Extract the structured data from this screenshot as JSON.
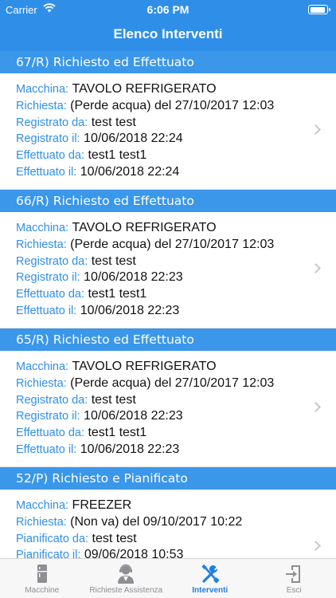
{
  "status_bar": {
    "carrier": "Carrier",
    "time": "6:06 PM",
    "battery_level": 0.95
  },
  "header": {
    "title": "Elenco Interventi"
  },
  "interventions": [
    {
      "header": "67/R) Richiesto ed Effettuato",
      "rows": [
        {
          "label": "Macchina:",
          "value": "TAVOLO REFRIGERATO"
        },
        {
          "label": "Richiesta:",
          "value": " (Perde acqua) del 27/10/2017 12:03"
        },
        {
          "label": "Registrato da:",
          "value": "test test"
        },
        {
          "label": "Registrato il:",
          "value": "10/06/2018 22:24"
        },
        {
          "label": "Effettuato da:",
          "value": "test1 test1"
        },
        {
          "label": "Effettuato il:",
          "value": "10/06/2018 22:24"
        }
      ]
    },
    {
      "header": "66/R) Richiesto ed Effettuato",
      "rows": [
        {
          "label": "Macchina:",
          "value": "TAVOLO REFRIGERATO"
        },
        {
          "label": "Richiesta:",
          "value": " (Perde acqua) del 27/10/2017 12:03"
        },
        {
          "label": "Registrato da:",
          "value": "test test"
        },
        {
          "label": "Registrato il:",
          "value": "10/06/2018 22:23"
        },
        {
          "label": "Effettuato da:",
          "value": "test1 test1"
        },
        {
          "label": "Effettuato il:",
          "value": "10/06/2018 22:23"
        }
      ]
    },
    {
      "header": "65/R) Richiesto ed Effettuato",
      "rows": [
        {
          "label": "Macchina:",
          "value": "TAVOLO REFRIGERATO"
        },
        {
          "label": "Richiesta:",
          "value": " (Perde acqua) del 27/10/2017 12:03"
        },
        {
          "label": "Registrato da:",
          "value": "test test"
        },
        {
          "label": "Registrato il:",
          "value": "10/06/2018 22:23"
        },
        {
          "label": "Effettuato da:",
          "value": "test1 test1"
        },
        {
          "label": "Effettuato il:",
          "value": "10/06/2018 22:23"
        }
      ]
    },
    {
      "header": "52/P) Richiesto e Pianificato",
      "rows": [
        {
          "label": "Macchina:",
          "value": "FREEZER"
        },
        {
          "label": "Richiesta:",
          "value": " (Non va) del 09/10/2017 10:22"
        },
        {
          "label": "Pianificato da:",
          "value": "test test"
        },
        {
          "label": "Pianificato il:",
          "value": "09/06/2018 10:53"
        }
      ]
    }
  ],
  "tabs": [
    {
      "label": "Macchine",
      "icon": "fridge-icon",
      "active": false
    },
    {
      "label": "Richieste Assistenza",
      "icon": "support-agent-icon",
      "active": false
    },
    {
      "label": "Interventi",
      "icon": "tools-icon",
      "active": true
    },
    {
      "label": "Esci",
      "icon": "exit-icon",
      "active": false
    }
  ],
  "colors": {
    "accent": "#2f8fe8",
    "section_header": "#3a97ea",
    "active_tab": "#1e7fe0",
    "inactive_tab": "#8e8e93"
  }
}
